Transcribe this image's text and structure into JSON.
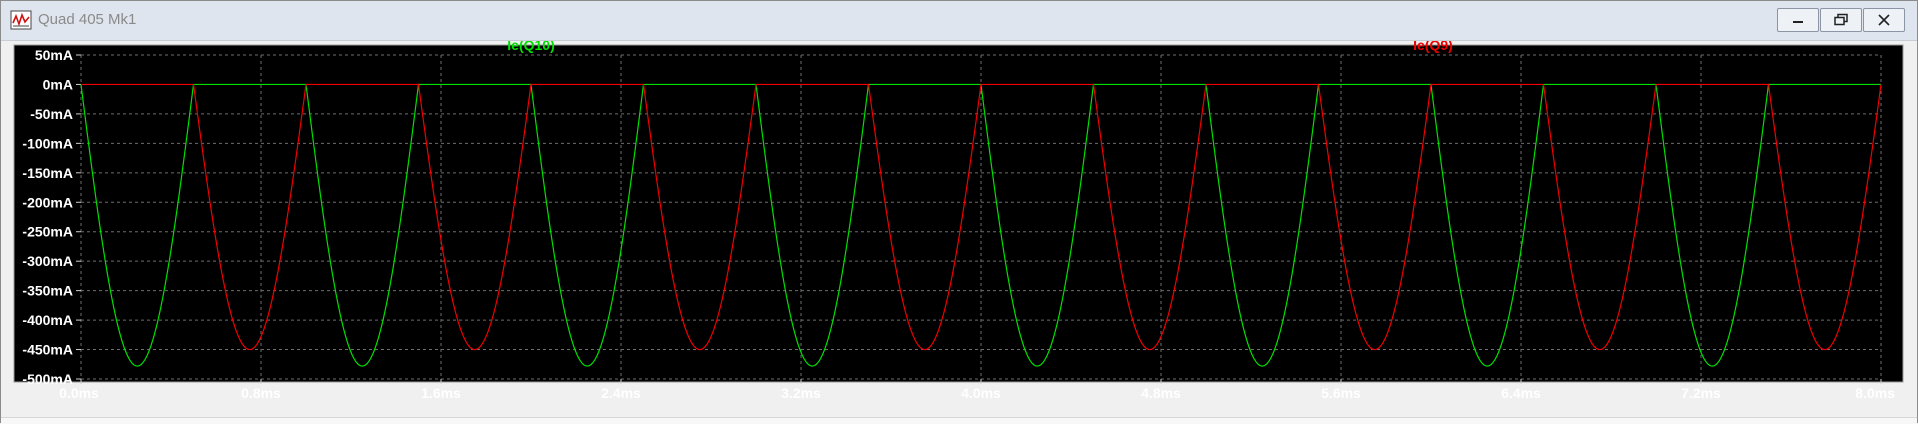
{
  "window": {
    "title": "Quad 405 Mk1",
    "icon": "waveform-icon",
    "controls": [
      "minimize-icon",
      "maximize-icon",
      "close-icon"
    ]
  },
  "chart_data": {
    "type": "line",
    "xlabel": "",
    "ylabel": "",
    "xlim": [
      0,
      8.0
    ],
    "ylim": [
      -500,
      50
    ],
    "x_unit": "ms",
    "y_unit": "mA",
    "x_ticks": [
      "0.0ms",
      "0.8ms",
      "1.6ms",
      "2.4ms",
      "3.2ms",
      "4.0ms",
      "4.8ms",
      "5.6ms",
      "6.4ms",
      "7.2ms",
      "8.0ms"
    ],
    "y_ticks": [
      "50mA",
      "0mA",
      "-50mA",
      "-100mA",
      "-150mA",
      "-200mA",
      "-250mA",
      "-300mA",
      "-350mA",
      "-400mA",
      "-450mA",
      "-500mA"
    ],
    "y_tick_values": [
      50,
      0,
      -50,
      -100,
      -150,
      -200,
      -250,
      -300,
      -350,
      -400,
      -450,
      -500
    ],
    "x_tick_values": [
      0,
      0.8,
      1.6,
      2.4,
      3.2,
      4.0,
      4.8,
      5.6,
      6.4,
      7.2,
      8.0
    ],
    "grid": true,
    "colors": {
      "background": "#000000",
      "grid": "#6e6e6e",
      "axis_text": "#ffffff"
    },
    "series": [
      {
        "name": "Ie(Q10)",
        "color": "#00e000",
        "period_ms": 1.0,
        "conduction_start_ms": 0.0,
        "conduction_end_ms": 0.5,
        "peak_mA": -478
      },
      {
        "name": "Ie(Q9)",
        "color": "#f00000",
        "period_ms": 1.0,
        "conduction_start_ms": 0.5,
        "conduction_end_ms": 1.0,
        "peak_mA": -450
      }
    ]
  }
}
